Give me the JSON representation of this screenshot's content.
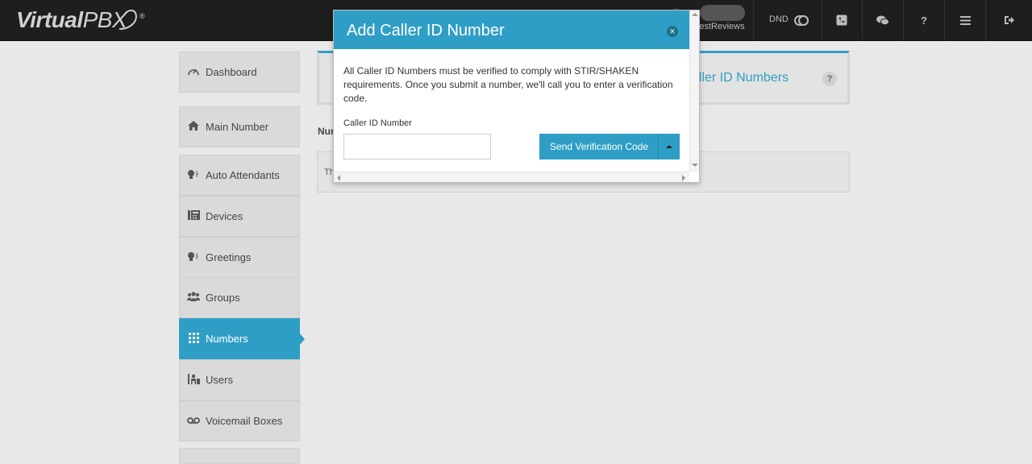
{
  "brand": {
    "name_part1": "Virtual",
    "name_part2": "PBX",
    "reg": "®"
  },
  "topbar": {
    "user_name": "BestReviews",
    "dnd_label": "DND",
    "icons": [
      "phone-icon",
      "chat-icon",
      "help-icon",
      "menu-icon",
      "logout-icon"
    ],
    "help_glyph": "?"
  },
  "sidebar": {
    "items": [
      {
        "label": "Dashboard",
        "icon": "dashboard-icon"
      },
      {
        "label": "Main Number",
        "icon": "home-icon"
      },
      {
        "label": "Auto Attendants",
        "icon": "auto-attendant-icon"
      },
      {
        "label": "Devices",
        "icon": "devices-icon"
      },
      {
        "label": "Greetings",
        "icon": "greetings-icon"
      },
      {
        "label": "Groups",
        "icon": "groups-icon"
      },
      {
        "label": "Numbers",
        "icon": "numbers-icon",
        "active": true
      },
      {
        "label": "Users",
        "icon": "users-icon"
      },
      {
        "label": "Voicemail Boxes",
        "icon": "voicemail-icon"
      }
    ]
  },
  "main": {
    "header_title": "aller ID Numbers",
    "help_badge": "?",
    "section_label": "Nur",
    "content_text": "Th"
  },
  "modal": {
    "title": "Add Caller ID Number",
    "description": "All Caller ID Numbers must be verified to comply with STIR/SHAKEN requirements. Once you submit a number, we'll call you to enter a verification code.",
    "field_label": "Caller ID Number",
    "field_value": "",
    "field_placeholder": "",
    "send_button_label": "Send Verification Code"
  },
  "colors": {
    "accent": "#2f9ec6",
    "topbar": "#1e1e1e",
    "background": "#e8e8e8"
  }
}
